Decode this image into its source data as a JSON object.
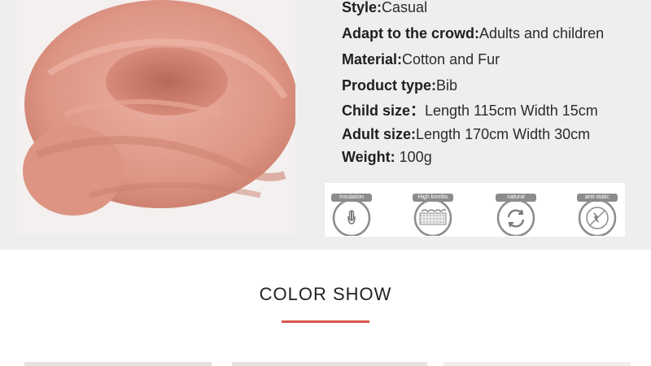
{
  "specs": [
    {
      "label": "Style:",
      "value": "Casual"
    },
    {
      "label": "Adapt to the crowd:",
      "value": "Adults and children"
    },
    {
      "label": "Material:",
      "value": "Cotton and Fur"
    },
    {
      "label": "Product type:",
      "value": "Bib"
    },
    {
      "label": "Child size：",
      "value": "Length 115cm Width 15cm"
    },
    {
      "label": "Adult size:",
      "value": "Length 170cm Width 30cm"
    },
    {
      "label": "Weight: ",
      "value": "100g"
    }
  ],
  "features": [
    {
      "label": "Insulation",
      "icon": "insulation-icon"
    },
    {
      "label": "High bombs",
      "icon": "high-bombs-icon"
    },
    {
      "label": "natural",
      "icon": "natural-icon"
    },
    {
      "label": "anti-static",
      "icon": "anti-static-icon"
    }
  ],
  "color_show": {
    "title": "COLOR  SHOW",
    "accent": "#d9534f"
  },
  "colors": {
    "scarf": "#e2998a",
    "panel_bg": "#eeeeee",
    "tag_bg": "#8c8c8c"
  }
}
